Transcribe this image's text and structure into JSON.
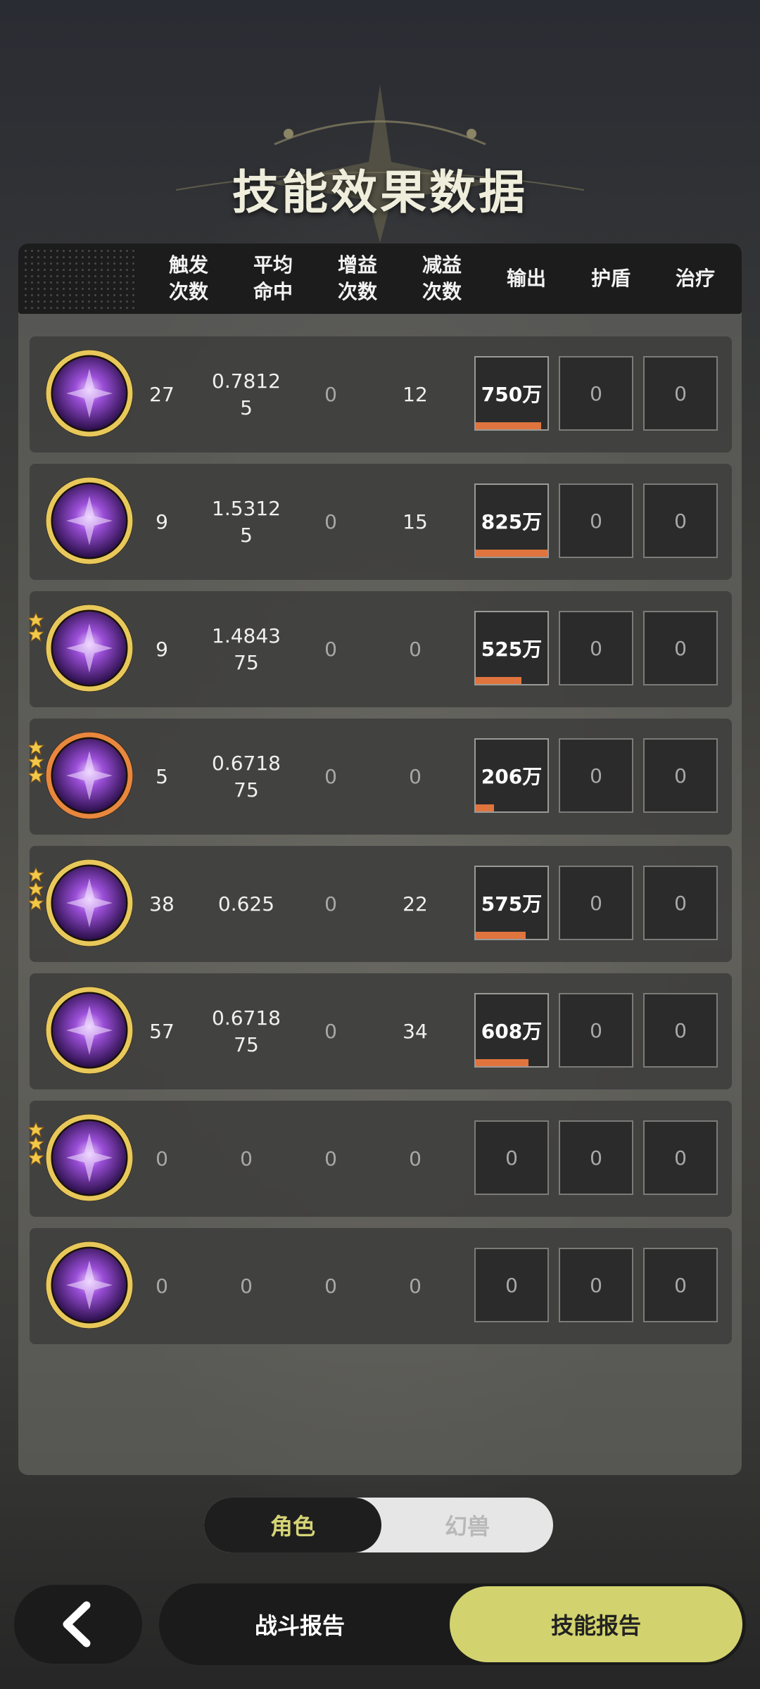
{
  "page_title": "技能效果数据",
  "columns": [
    {
      "l1": "触发",
      "l2": "次数"
    },
    {
      "l1": "平均",
      "l2": "命中"
    },
    {
      "l1": "增益",
      "l2": "次数"
    },
    {
      "l1": "减益",
      "l2": "次数"
    },
    {
      "l1": "输出",
      "l2": ""
    },
    {
      "l1": "护盾",
      "l2": ""
    },
    {
      "l1": "治疗",
      "l2": ""
    }
  ],
  "rows": [
    {
      "icon": "shatter-burst-skill-icon",
      "ring": "gold",
      "stars": 0,
      "triggers": "27",
      "avg_hit": "0.78125",
      "buffs": "0",
      "debuffs": "12",
      "output": "750万",
      "output_bar": 0.91,
      "shield": "0",
      "heal": "0"
    },
    {
      "icon": "raised-fist-skill-icon",
      "ring": "gold",
      "stars": 0,
      "triggers": "9",
      "avg_hit": "1.53125",
      "buffs": "0",
      "debuffs": "15",
      "output": "825万",
      "output_bar": 1.0,
      "shield": "0",
      "heal": "0"
    },
    {
      "icon": "purple-vortex-skill-icon",
      "ring": "gold",
      "stars": 2,
      "triggers": "9",
      "avg_hit": "1.484375",
      "buffs": "0",
      "debuffs": "0",
      "output": "525万",
      "output_bar": 0.64,
      "shield": "0",
      "heal": "0"
    },
    {
      "icon": "sparkle-star-skill-icon",
      "ring": "orange",
      "stars": 3,
      "triggers": "5",
      "avg_hit": "0.671875",
      "buffs": "0",
      "debuffs": "0",
      "output": "206万",
      "output_bar": 0.25,
      "shield": "0",
      "heal": "0"
    },
    {
      "icon": "eye-sigil-skill-icon",
      "ring": "gold",
      "stars": 3,
      "triggers": "38",
      "avg_hit": "0.625",
      "buffs": "0",
      "debuffs": "22",
      "output": "575万",
      "output_bar": 0.7,
      "shield": "0",
      "heal": "0"
    },
    {
      "icon": "eye-pillar-skill-icon",
      "ring": "gold",
      "stars": 0,
      "triggers": "57",
      "avg_hit": "0.671875",
      "buffs": "0",
      "debuffs": "34",
      "output": "608万",
      "output_bar": 0.74,
      "shield": "0",
      "heal": "0"
    },
    {
      "icon": "golden-uplift-skill-icon",
      "ring": "gold",
      "stars": 3,
      "triggers": "0",
      "avg_hit": "0",
      "buffs": "0",
      "debuffs": "0",
      "output": "0",
      "output_bar": 0,
      "shield": "0",
      "heal": "0"
    },
    {
      "icon": "figure-arrow-skill-icon",
      "ring": "gold",
      "stars": 0,
      "triggers": "0",
      "avg_hit": "0",
      "buffs": "0",
      "debuffs": "0",
      "output": "0",
      "output_bar": 0,
      "shield": "0",
      "heal": "0"
    }
  ],
  "toggle": {
    "selected": "角色",
    "other": "幻兽"
  },
  "bottom_nav": {
    "battle_report": "战斗报告",
    "skill_report": "技能报告"
  },
  "colors": {
    "accent": "#d2d36e",
    "bar": "#e0743e",
    "gold_ring": "#e8c85a",
    "orange_ring": "#e8873e"
  }
}
